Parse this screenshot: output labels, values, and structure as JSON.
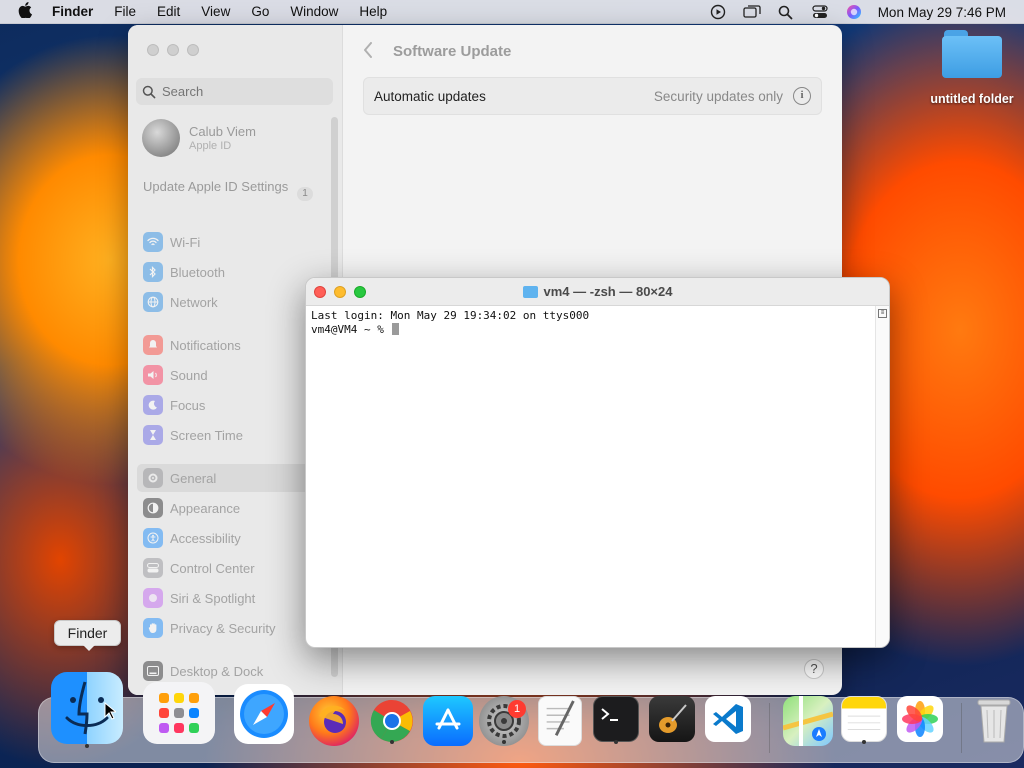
{
  "menubar": {
    "app_name": "Finder",
    "menus": [
      "File",
      "Edit",
      "View",
      "Go",
      "Window",
      "Help"
    ],
    "clock": "Mon May 29  7:46 PM"
  },
  "desktop": {
    "folder_label": "untitled folder"
  },
  "settings": {
    "search_placeholder": "Search",
    "account": {
      "name": "Calub Viem",
      "subtitle": "Apple ID"
    },
    "update_apple_id": {
      "label": "Update Apple ID Settings",
      "badge": "1"
    },
    "sidebar_items": [
      {
        "label": "Wi-Fi",
        "color": "#1e88e5"
      },
      {
        "label": "Bluetooth",
        "color": "#1e88e5"
      },
      {
        "label": "Network",
        "color": "#1e88e5"
      },
      {
        "label": "Notifications",
        "color": "#ff3b30"
      },
      {
        "label": "Sound",
        "color": "#ff2d55"
      },
      {
        "label": "Focus",
        "color": "#5e5ce6"
      },
      {
        "label": "Screen Time",
        "color": "#5e5ce6"
      },
      {
        "label": "General",
        "color": "#8e8e93"
      },
      {
        "label": "Appearance",
        "color": "#1c1c1e"
      },
      {
        "label": "Accessibility",
        "color": "#0a84ff"
      },
      {
        "label": "Control Center",
        "color": "#8e8e93"
      },
      {
        "label": "Siri & Spotlight",
        "color": "#bf5af2"
      },
      {
        "label": "Privacy & Security",
        "color": "#0a84ff"
      },
      {
        "label": "Desktop & Dock",
        "color": "#1c1c1e"
      }
    ],
    "selected_item": "General",
    "page_title": "Software Update",
    "auto_updates": {
      "label": "Automatic updates",
      "value": "Security updates only"
    },
    "help_label": "?"
  },
  "terminal": {
    "title": "vm4 — -zsh — 80×24",
    "lines": [
      "Last login: Mon May 29 19:34:02 on ttys000",
      "vm4@VM4 ~ % "
    ]
  },
  "tooltip": {
    "text": "Finder"
  },
  "dock": {
    "apps": [
      {
        "name": "Finder",
        "running": true
      },
      {
        "name": "Launchpad",
        "running": false
      },
      {
        "name": "Safari",
        "running": false
      },
      {
        "name": "Firefox",
        "running": false
      },
      {
        "name": "Chrome",
        "running": true
      },
      {
        "name": "App Store",
        "running": false
      },
      {
        "name": "System Settings",
        "running": true,
        "badge": "1"
      },
      {
        "name": "TextEdit",
        "running": false
      },
      {
        "name": "Terminal",
        "running": true
      },
      {
        "name": "GarageBand",
        "running": false
      },
      {
        "name": "Visual Studio Code",
        "running": false
      },
      {
        "name": "Maps",
        "running": false
      },
      {
        "name": "Notes",
        "running": true
      },
      {
        "name": "Photos",
        "running": false
      },
      {
        "name": "Trash",
        "running": false
      }
    ]
  }
}
